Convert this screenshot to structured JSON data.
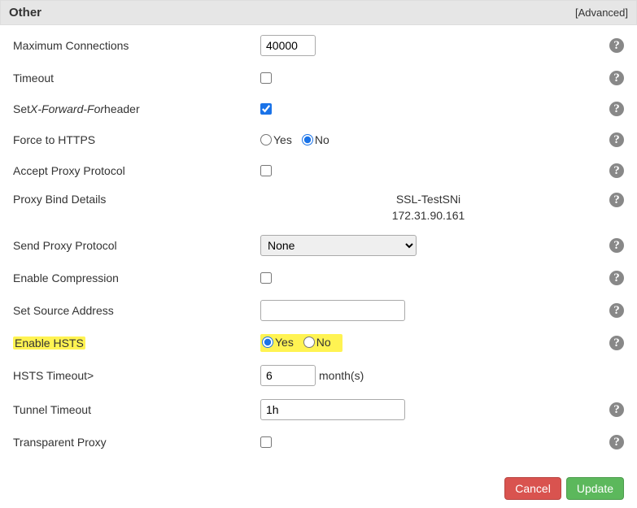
{
  "header": {
    "title": "Other",
    "advanced": "[Advanced]"
  },
  "rows": {
    "maxConn": {
      "label": "Maximum Connections",
      "value": "40000"
    },
    "timeout": {
      "label": "Timeout",
      "checked": false
    },
    "xff": {
      "labelPrefix": "Set ",
      "labelItalic": "X-Forward-For",
      "labelSuffix": " header",
      "checked": true
    },
    "forceHttps": {
      "label": "Force to HTTPS",
      "yesLabel": "Yes",
      "noLabel": "No",
      "value": "No"
    },
    "acceptProxy": {
      "label": "Accept Proxy Protocol",
      "checked": false
    },
    "proxyBind": {
      "label": "Proxy Bind Details",
      "line1": "SSL-TestSNi",
      "line2": "172.31.90.161"
    },
    "sendProxy": {
      "label": "Send Proxy Protocol",
      "options": [
        "None"
      ],
      "value": "None"
    },
    "enableCompression": {
      "label": "Enable Compression",
      "checked": false
    },
    "setSource": {
      "label": "Set Source Address",
      "value": ""
    },
    "enableHsts": {
      "label": "Enable HSTS",
      "yesLabel": "Yes",
      "noLabel": "No",
      "value": "Yes"
    },
    "hstsTimeout": {
      "label": "HSTS Timeout>",
      "value": "6",
      "unit": "month(s)"
    },
    "tunnelTimeout": {
      "label": "Tunnel Timeout",
      "value": "1h"
    },
    "transparentProxy": {
      "label": "Transparent Proxy",
      "checked": false
    }
  },
  "footer": {
    "cancel": "Cancel",
    "update": "Update"
  }
}
